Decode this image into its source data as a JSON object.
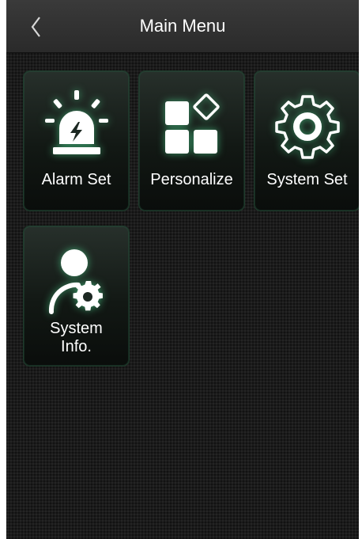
{
  "header": {
    "title": "Main Menu",
    "back_icon": "chevron-left-icon"
  },
  "menu": {
    "items": [
      {
        "label": "Alarm Set",
        "icon": "alarm-siren-icon"
      },
      {
        "label": "Personalize",
        "icon": "personalize-grid-icon"
      },
      {
        "label": "System Set",
        "icon": "gear-icon"
      },
      {
        "label": "System Info.",
        "icon": "user-gear-icon"
      }
    ]
  },
  "colors": {
    "accent_white": "#ffffff",
    "tile_border": "#1f3b2c",
    "background": "#1b1b1b"
  }
}
